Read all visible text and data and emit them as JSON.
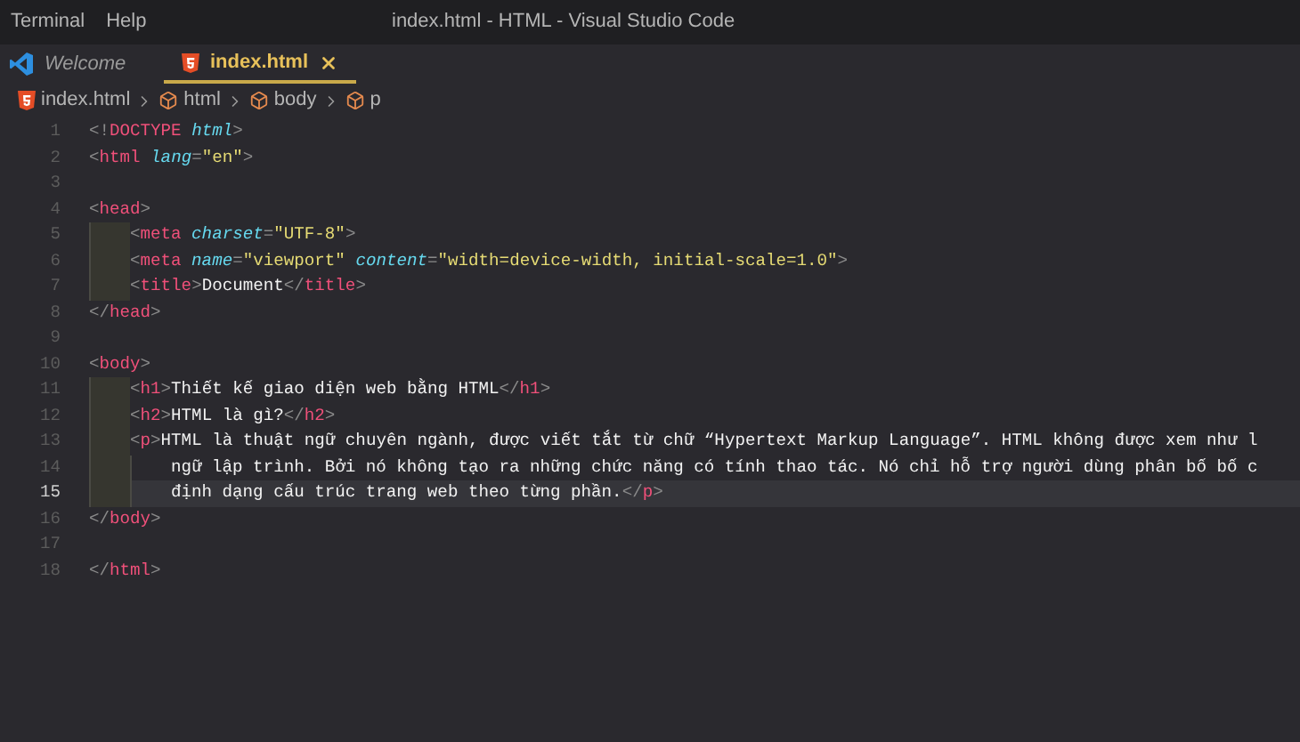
{
  "window": {
    "title": "index.html - HTML - Visual Studio Code"
  },
  "menu": [
    "Terminal",
    "Help"
  ],
  "tabs": [
    {
      "label": "Welcome",
      "kind": "welcome",
      "selected": false
    },
    {
      "label": "index.html",
      "kind": "html",
      "selected": true
    }
  ],
  "breadcrumb": [
    {
      "label": "index.html",
      "kind": "file"
    },
    {
      "label": "html",
      "kind": "element"
    },
    {
      "label": "body",
      "kind": "element"
    },
    {
      "label": "p",
      "kind": "element"
    }
  ],
  "lines": [
    {
      "number": "1",
      "current": false,
      "tokens": [
        {
          "kind": "punct",
          "text": "<!"
        },
        {
          "kind": "tag",
          "text": "DOCTYPE"
        },
        {
          "kind": "attr",
          "text": " html"
        },
        {
          "kind": "punct",
          "text": ">"
        }
      ]
    },
    {
      "number": "2",
      "current": false,
      "tokens": [
        {
          "kind": "punct",
          "text": "<"
        },
        {
          "kind": "tag",
          "text": "html"
        },
        {
          "kind": "attr",
          "text": " lang"
        },
        {
          "kind": "punct",
          "text": "="
        },
        {
          "kind": "string",
          "text": "\"en\""
        },
        {
          "kind": "punct",
          "text": ">"
        }
      ]
    },
    {
      "number": "3",
      "current": false
    },
    {
      "number": "4",
      "current": false,
      "tokens": [
        {
          "kind": "punct",
          "text": "<"
        },
        {
          "kind": "tag",
          "text": "head"
        },
        {
          "kind": "punct",
          "text": ">"
        }
      ],
      "children": [
        {
          "number": "5",
          "current": false,
          "tokens": [
            {
              "kind": "punct",
              "text": "<"
            },
            {
              "kind": "tag",
              "text": "meta"
            },
            {
              "kind": "attr",
              "text": " charset"
            },
            {
              "kind": "punct",
              "text": "="
            },
            {
              "kind": "string",
              "text": "\"UTF-8\""
            },
            {
              "kind": "punct",
              "text": ">"
            }
          ]
        },
        {
          "number": "6",
          "current": false,
          "tokens": [
            {
              "kind": "punct",
              "text": "<"
            },
            {
              "kind": "tag",
              "text": "meta"
            },
            {
              "kind": "attr",
              "text": " name"
            },
            {
              "kind": "punct",
              "text": "="
            },
            {
              "kind": "string",
              "text": "\"viewport\""
            },
            {
              "kind": "attr",
              "text": " content"
            },
            {
              "kind": "punct",
              "text": "="
            },
            {
              "kind": "string",
              "text": "\"width=device-width, initial-scale=1.0\""
            },
            {
              "kind": "punct",
              "text": ">"
            }
          ]
        },
        {
          "number": "7",
          "current": false,
          "tokens": [
            {
              "kind": "punct",
              "text": "<"
            },
            {
              "kind": "tag",
              "text": "title"
            },
            {
              "kind": "punct",
              "text": ">"
            },
            {
              "kind": "text",
              "text": "Document"
            },
            {
              "kind": "punct",
              "text": "</"
            },
            {
              "kind": "tag",
              "text": "title"
            },
            {
              "kind": "punct",
              "text": ">"
            }
          ]
        }
      ]
    },
    {
      "number": "8",
      "current": false,
      "tokens": [
        {
          "kind": "punct",
          "text": "</"
        },
        {
          "kind": "tag",
          "text": "head"
        },
        {
          "kind": "punct",
          "text": ">"
        }
      ]
    },
    {
      "number": "9",
      "current": false
    },
    {
      "number": "10",
      "current": false,
      "tokens": [
        {
          "kind": "punct",
          "text": "<"
        },
        {
          "kind": "tag",
          "text": "body"
        },
        {
          "kind": "punct",
          "text": ">"
        }
      ],
      "children": [
        {
          "number": "11",
          "current": false,
          "tokens": [
            {
              "kind": "punct",
              "text": "<"
            },
            {
              "kind": "tag",
              "text": "h1"
            },
            {
              "kind": "punct",
              "text": ">"
            },
            {
              "kind": "text",
              "text": "Thiết kế giao diện web bằng HTML"
            },
            {
              "kind": "punct",
              "text": "</"
            },
            {
              "kind": "tag",
              "text": "h1"
            },
            {
              "kind": "punct",
              "text": ">"
            }
          ]
        },
        {
          "number": "12",
          "current": false,
          "tokens": [
            {
              "kind": "punct",
              "text": "<"
            },
            {
              "kind": "tag",
              "text": "h2"
            },
            {
              "kind": "punct",
              "text": ">"
            },
            {
              "kind": "text",
              "text": "HTML là gì?"
            },
            {
              "kind": "punct",
              "text": "</"
            },
            {
              "kind": "tag",
              "text": "h2"
            },
            {
              "kind": "punct",
              "text": ">"
            }
          ]
        },
        {
          "number": "13",
          "current": false,
          "tokens": [
            {
              "kind": "punct",
              "text": "<"
            },
            {
              "kind": "tag",
              "text": "p"
            },
            {
              "kind": "punct",
              "text": ">"
            },
            {
              "kind": "text",
              "text": "HTML là thuật ngữ chuyên ngành, được viết tắt từ chữ “Hypertext Markup Language”. HTML không được xem như l"
            }
          ],
          "children": [
            {
              "number": "14",
              "current": false,
              "tokens": [
                {
                  "kind": "text",
                  "text": "ngữ lập trình. Bởi nó không tạo ra những chức năng có tính thao tác. Nó chỉ hỗ trợ người dùng phân bố bố c"
                }
              ]
            },
            {
              "number": "15",
              "current": true,
              "tokens": [
                {
                  "kind": "text",
                  "text": "định dạng cấu trúc trang web theo từng phần."
                },
                {
                  "kind": "punct",
                  "text": "</"
                },
                {
                  "kind": "tag",
                  "text": "p"
                },
                {
                  "kind": "punct",
                  "text": ">"
                }
              ]
            }
          ]
        }
      ]
    },
    {
      "number": "16",
      "current": false,
      "tokens": [
        {
          "kind": "punct",
          "text": "</"
        },
        {
          "kind": "tag",
          "text": "body"
        },
        {
          "kind": "punct",
          "text": ">"
        }
      ]
    },
    {
      "number": "17",
      "current": false
    },
    {
      "number": "18",
      "current": false,
      "tokens": [
        {
          "kind": "punct",
          "text": "</"
        },
        {
          "kind": "tag",
          "text": "html"
        },
        {
          "kind": "punct",
          "text": ">"
        }
      ]
    }
  ]
}
